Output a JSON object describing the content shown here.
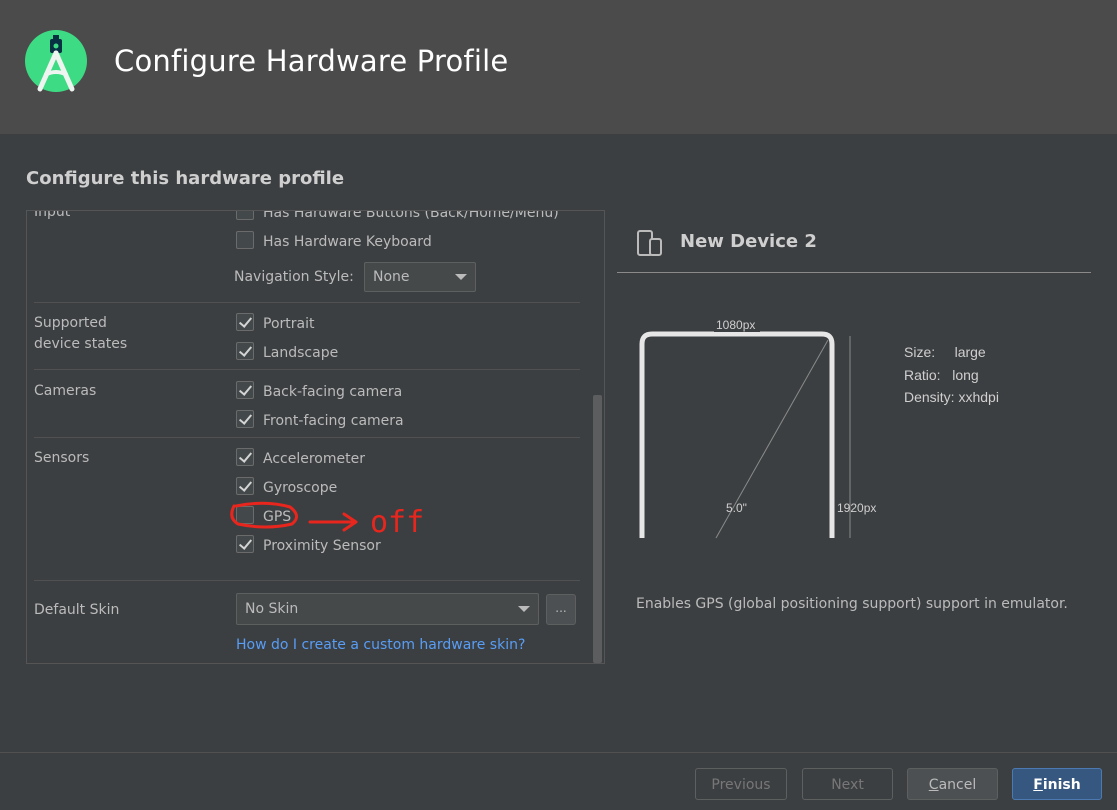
{
  "header": {
    "title": "Configure Hardware Profile"
  },
  "section_title": "Configure this hardware profile",
  "input_group": {
    "label": "Input",
    "options": [
      {
        "label": "Has Hardware Buttons (Back/Home/Menu)",
        "checked": false
      },
      {
        "label": "Has Hardware Keyboard",
        "checked": false
      }
    ],
    "navigation_style_label": "Navigation Style:",
    "navigation_style_value": "None"
  },
  "device_states": {
    "label_line1": "Supported",
    "label_line2": "device states",
    "options": [
      {
        "label": "Portrait",
        "checked": true
      },
      {
        "label": "Landscape",
        "checked": true
      }
    ]
  },
  "cameras": {
    "label": "Cameras",
    "options": [
      {
        "label": "Back-facing camera",
        "checked": true
      },
      {
        "label": "Front-facing camera",
        "checked": true
      }
    ]
  },
  "sensors": {
    "label": "Sensors",
    "options": [
      {
        "label": "Accelerometer",
        "checked": true
      },
      {
        "label": "Gyroscope",
        "checked": true
      },
      {
        "label": "GPS",
        "checked": false
      },
      {
        "label": "Proximity Sensor",
        "checked": true
      }
    ]
  },
  "default_skin": {
    "label": "Default Skin",
    "value": "No Skin",
    "browse_label": "...",
    "help_link": "How do I create a custom hardware skin?"
  },
  "annotation": {
    "text": "off",
    "color": "#e8261e"
  },
  "device": {
    "name": "New Device 2",
    "width_px": "1080px",
    "height_px": "1920px",
    "diagonal": "5.0\"",
    "size_label": "Size:",
    "size_value": "large",
    "ratio_label": "Ratio:",
    "ratio_value": "long",
    "density_label": "Density:",
    "density_value": "xxhdpi",
    "description": "Enables GPS (global positioning support) support in emulator."
  },
  "buttons": {
    "previous": "Previous",
    "next": "Next",
    "cancel_first": "C",
    "cancel_rest": "ancel",
    "finish_first": "F",
    "finish_rest": "inish"
  },
  "colors": {
    "accent": "#589df6",
    "primary_button": "#365880",
    "logo_green": "#3ddc84"
  }
}
